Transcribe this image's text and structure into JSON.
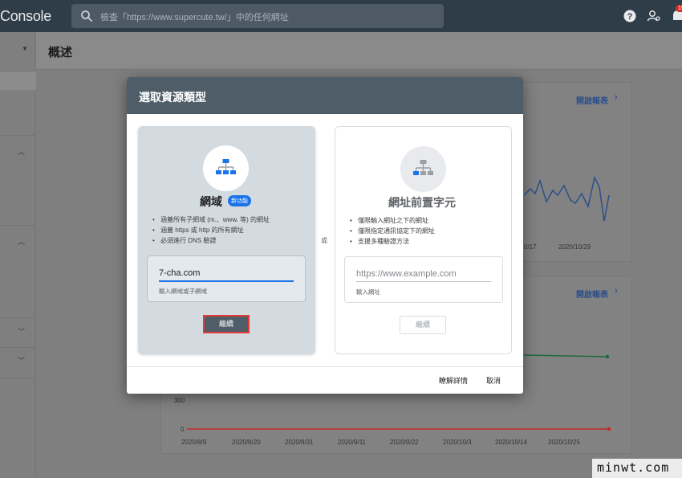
{
  "app": {
    "title": "Console"
  },
  "search": {
    "placeholder": "檢查「https://www.supercute.tw/」中的任何網址"
  },
  "topbar": {
    "notification_count": "15"
  },
  "page": {
    "title": "概述"
  },
  "cards": {
    "open_report_1": "開啟報表",
    "open_report_2": "開啟報表",
    "chart1_dates": [
      "0/17",
      "2020/10/29"
    ],
    "chart2_yticks": [
      "300",
      "0"
    ],
    "chart2_dates": [
      "2020/8/9",
      "2020/8/20",
      "2020/8/31",
      "2020/9/11",
      "2020/9/22",
      "2020/10/3",
      "2020/10/14",
      "2020/10/25"
    ]
  },
  "dialog": {
    "title": "選取資源類型",
    "or": "或",
    "domain": {
      "name": "網域",
      "badge": "新功能",
      "bullets": [
        "涵蓋所有子網域 (m.、www. 等) 的網址",
        "涵蓋 https 或 http 的所有網址",
        "必須進行 DNS 驗證"
      ],
      "input_value": "7-cha.com",
      "input_hint": "輸入網域或子網域",
      "continue": "繼續"
    },
    "prefix": {
      "name": "網址前置字元",
      "bullets": [
        "僅限輸入網址之下的網址",
        "僅限指定通訊協定下的網址",
        "支援多種驗證方法"
      ],
      "input_placeholder": "https://www.example.com",
      "input_hint": "輸入網址",
      "continue": "繼續"
    },
    "learn_more": "瞭解詳情",
    "cancel": "取消"
  },
  "watermark": "minwt.com",
  "colors": {
    "accent": "#1a73e8",
    "header": "#4e5d68",
    "highlight": "#e53935"
  }
}
